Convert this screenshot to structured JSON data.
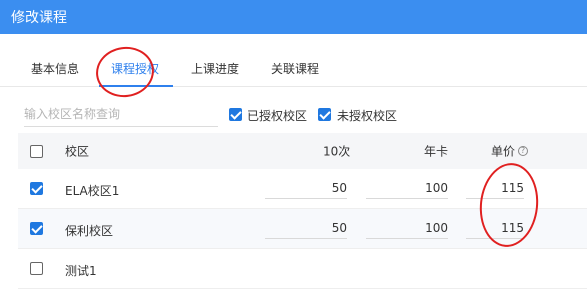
{
  "header": {
    "title": "修改课程"
  },
  "tabs": [
    {
      "label": "基本信息"
    },
    {
      "label": "课程授权"
    },
    {
      "label": "上课进度"
    },
    {
      "label": "关联课程"
    }
  ],
  "filters": {
    "search_placeholder": "输入校区名称查询",
    "authorized_label": "已授权校区",
    "authorized_checked": true,
    "unauthorized_label": "未授权校区",
    "unauthorized_checked": true
  },
  "table": {
    "columns": {
      "campus": "校区",
      "ten_sessions": "10次",
      "annual_card": "年卡",
      "unit_price": "单价"
    },
    "rows": [
      {
        "checked": true,
        "campus": "ELA校区1",
        "ten_sessions": "50",
        "annual_card": "100",
        "unit_price": "115"
      },
      {
        "checked": true,
        "campus": "保利校区",
        "ten_sessions": "50",
        "annual_card": "100",
        "unit_price": "115"
      },
      {
        "checked": false,
        "campus": "测试1",
        "ten_sessions": "",
        "annual_card": "",
        "unit_price": ""
      }
    ]
  },
  "colors": {
    "header": "#3b8ef0",
    "accent": "#2f80ed",
    "checkbox": "#1f78e0",
    "annotation": "#e02020"
  },
  "icons": {
    "unit_price_help": "question-circle-icon"
  }
}
